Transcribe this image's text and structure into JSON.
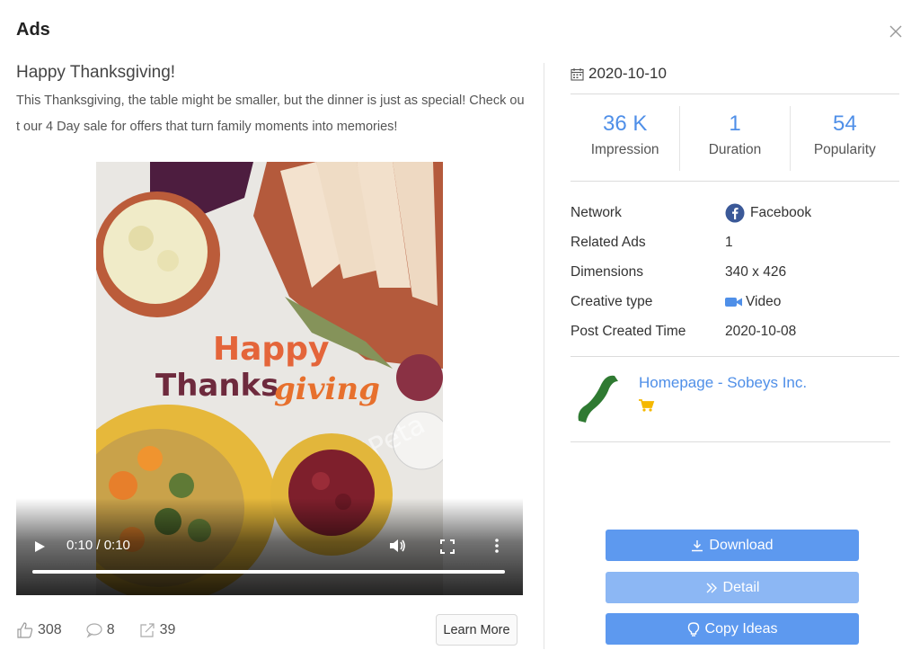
{
  "modal": {
    "title": "Ads"
  },
  "ad": {
    "title": "Happy Thanksgiving!",
    "text": "This Thanksgiving, the table might be smaller, but the dinner is just as special! Check out our 4 Day sale for offers that turn family moments into memories!",
    "image_text": {
      "line1": "Happy",
      "line2_a": "Thanks",
      "line2_b": "giving",
      "watermark": "SocialPeta"
    }
  },
  "video": {
    "time": "0:10 / 0:10",
    "progress": 1.0
  },
  "stats": {
    "likes": "308",
    "comments": "8",
    "shares": "39"
  },
  "cta": {
    "label": "Learn More"
  },
  "details": {
    "date": "2020-10-10",
    "metrics": [
      {
        "value": "36 K",
        "label": "Impression"
      },
      {
        "value": "1",
        "label": "Duration"
      },
      {
        "value": "54",
        "label": "Popularity"
      }
    ],
    "info": [
      {
        "key": "Network",
        "value": "Facebook",
        "icon": "facebook-icon"
      },
      {
        "key": "Related Ads",
        "value": "1"
      },
      {
        "key": "Dimensions",
        "value": "340 x 426"
      },
      {
        "key": "Creative type",
        "value": "Video",
        "icon": "video-camera-icon"
      },
      {
        "key": "Post Created Time",
        "value": "2020-10-08"
      }
    ],
    "advertiser": {
      "name": "Homepage - Sobeys Inc."
    }
  },
  "actions": {
    "download": "Download",
    "detail": "Detail",
    "copy_ideas": "Copy Ideas"
  },
  "colors": {
    "accent": "#4f8fe8",
    "button_primary": "#5d99ef",
    "button_light": "#8cb7f4",
    "facebook": "#3b5998",
    "cart": "#f5b800"
  }
}
